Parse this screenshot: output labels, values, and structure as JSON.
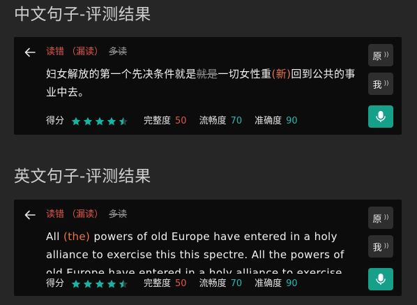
{
  "sections": [
    {
      "title": "中文句子-评测结果",
      "legend": {
        "wrong": "读错",
        "miss": "（漏读）",
        "extra": "多读"
      },
      "sentence": [
        {
          "text": "妇女解放的第一个先决条件就是",
          "style": "normal"
        },
        {
          "text": "就是",
          "style": "strike"
        },
        {
          "text": "一切女性重",
          "style": "normal"
        },
        {
          "text": "(新)",
          "style": "missed"
        },
        {
          "text": "回到公共的事业中去。",
          "style": "normal"
        }
      ],
      "scores": {
        "label": "得分",
        "stars": 4.5,
        "metrics": [
          {
            "label": "完整度",
            "value": "50",
            "color": "red"
          },
          {
            "label": "流畅度",
            "value": "70",
            "color": "cyan"
          },
          {
            "label": "准确度",
            "value": "90",
            "color": "cyan"
          }
        ]
      },
      "buttons": {
        "original": "原",
        "mine": "我"
      }
    },
    {
      "title": "英文句子-评测结果",
      "legend": {
        "wrong": "读错",
        "miss": "（漏读）",
        "extra": "多读"
      },
      "sentence": [
        {
          "text": "All ",
          "style": "normal"
        },
        {
          "text": "(the)",
          "style": "missed"
        },
        {
          "text": " powers of old Europe have entered in a holy alliance to exercise this this spectre. All the powers of old Europe have entered in a holy alliance to exercise this",
          "style": "normal"
        }
      ],
      "scores": {
        "label": "得分",
        "stars": 4.5,
        "metrics": [
          {
            "label": "完整度",
            "value": "50",
            "color": "red"
          },
          {
            "label": "流畅度",
            "value": "70",
            "color": "cyan"
          },
          {
            "label": "准确度",
            "value": "90",
            "color": "cyan"
          }
        ]
      },
      "buttons": {
        "original": "原",
        "mine": "我"
      }
    }
  ],
  "colors": {
    "accent": "#16a08a",
    "star": "#17b3a5",
    "error": "#e0574c",
    "missed": "#e8744a"
  }
}
